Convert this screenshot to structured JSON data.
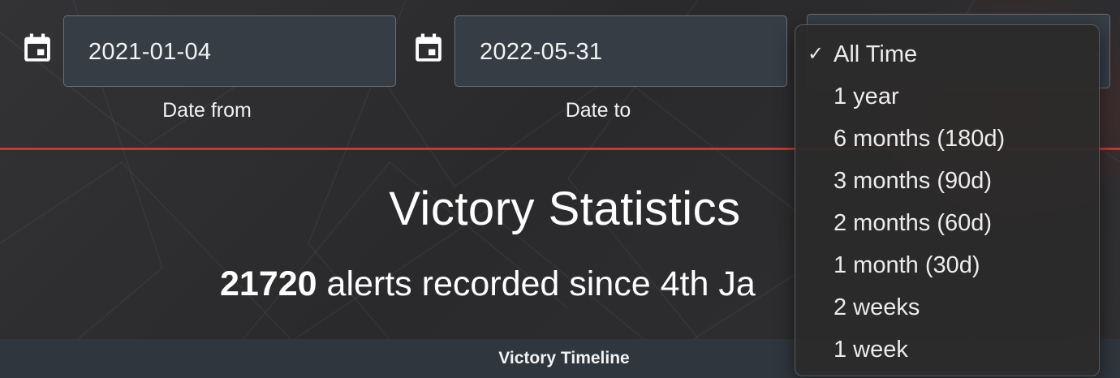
{
  "filters": {
    "date_from": {
      "value": "2021-01-04",
      "label": "Date from",
      "icon": "calendar-icon"
    },
    "date_to": {
      "value": "2022-05-31",
      "label": "Date to",
      "icon": "calendar-icon"
    },
    "range_select": {
      "selected": "All Time",
      "options": [
        "All Time",
        "1 year",
        "6 months (180d)",
        "3 months (90d)",
        "2 months (60d)",
        "1 month (30d)",
        "2 weeks",
        "1 week"
      ],
      "check_glyph": "✓"
    }
  },
  "main": {
    "title": "Victory Statistics",
    "summary_count": "21720",
    "summary_text": "alerts recorded since 4th Ja"
  },
  "timeline": {
    "title": "Victory Timeline"
  },
  "colors": {
    "accent": "#c23a32",
    "input_bg": "#363d45",
    "page_bg": "#2b2b2d"
  }
}
